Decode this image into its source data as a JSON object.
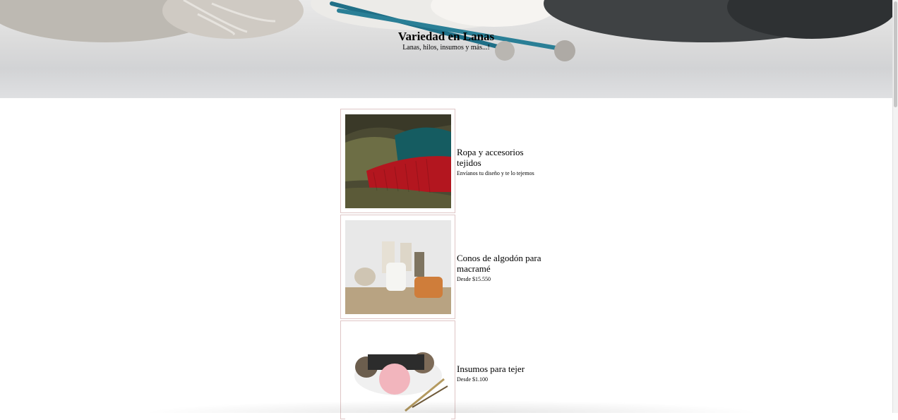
{
  "hero": {
    "title": "Variedad en Lanas",
    "subtitle": "Lanas, hilos, insumos y más...!"
  },
  "products": [
    {
      "title": "Ropa y accesorios tejidos",
      "detail": "Envíanos tu diseño y te lo tejemos",
      "image": "knitted-beanies"
    },
    {
      "title": "Conos de algodón para macramé",
      "detail": "Desde $15.550",
      "image": "macrame-cotton-cones"
    },
    {
      "title": "Insumos para tejer",
      "detail": "Desde $1.100",
      "image": "yarn-and-needles"
    }
  ],
  "colors": {
    "card_border": "#dfc6c6",
    "background": "#ffffff"
  }
}
